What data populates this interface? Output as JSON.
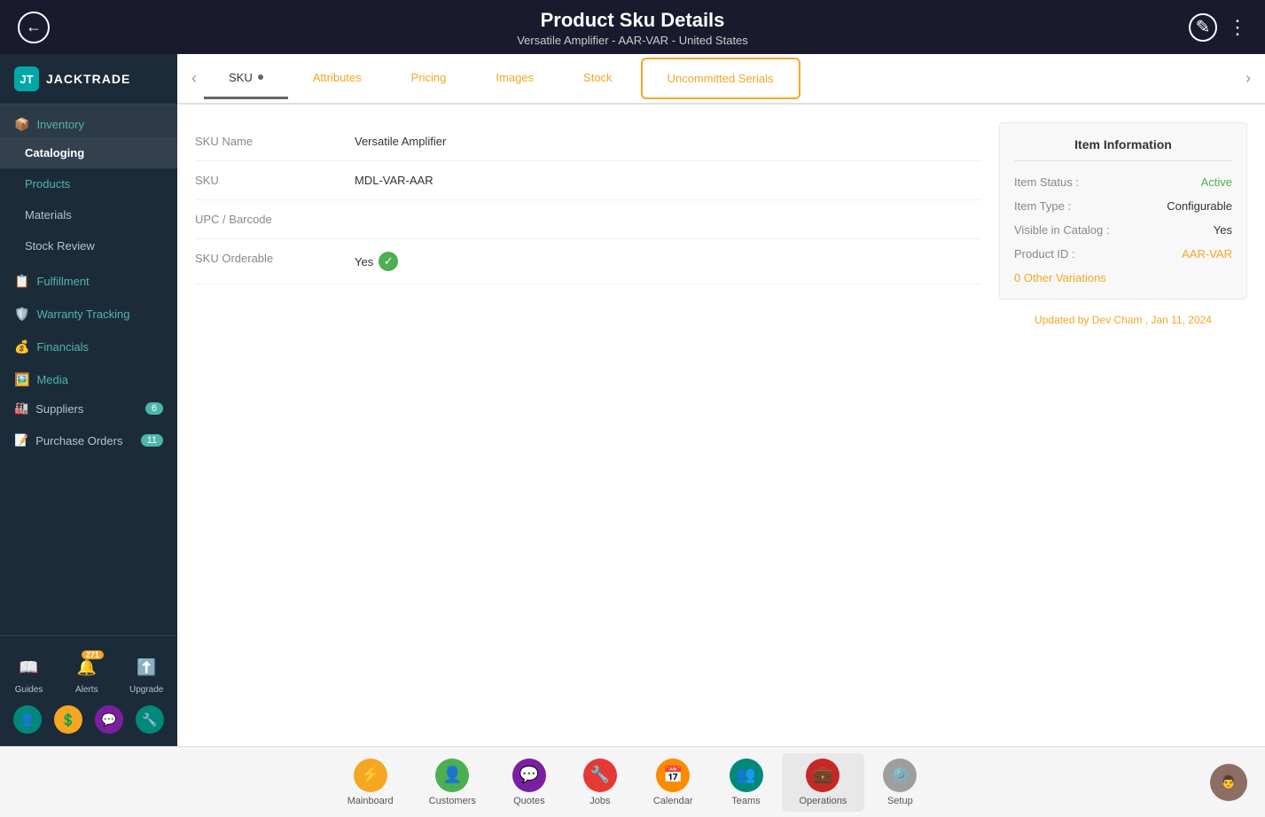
{
  "header": {
    "title": "Product Sku Details",
    "subtitle": "Versatile Amplifier - AAR-VAR - United States",
    "back_label": "←",
    "edit_icon": "✎",
    "more_icon": "⋮"
  },
  "sidebar": {
    "logo_text": "JACKTRADE",
    "sections": [
      {
        "name": "Inventory",
        "icon": "📦",
        "active": true,
        "sub_items": [
          {
            "label": "Cataloging",
            "active": true,
            "indent": true
          },
          {
            "label": "Products",
            "active_cyan": true,
            "indent": true
          },
          {
            "label": "Materials",
            "indent": true
          },
          {
            "label": "Stock Review",
            "indent": true
          }
        ]
      },
      {
        "name": "Fulfillment",
        "icon": "📋"
      },
      {
        "name": "Warranty Tracking",
        "icon": "🛡️"
      },
      {
        "name": "Financials",
        "icon": "💰"
      },
      {
        "name": "Media",
        "icon": "🖼️"
      },
      {
        "name": "Suppliers",
        "icon": "🏭",
        "badge": "6"
      },
      {
        "name": "Purchase Orders",
        "icon": "📝",
        "badge": "11"
      }
    ],
    "bottom": {
      "guides_label": "Guides",
      "alerts_label": "Alerts",
      "alerts_badge": "271",
      "upgrade_label": "Upgrade"
    }
  },
  "tabs": [
    {
      "label": "SKU",
      "active": true
    },
    {
      "label": "Attributes",
      "orange": true
    },
    {
      "label": "Pricing",
      "orange": true
    },
    {
      "label": "Images",
      "orange": true
    },
    {
      "label": "Stock",
      "orange": true
    },
    {
      "label": "Uncommitted Serials",
      "bordered": true
    }
  ],
  "fields": [
    {
      "label": "SKU Name",
      "value": "Versatile Amplifier",
      "type": "text"
    },
    {
      "label": "SKU",
      "value": "MDL-VAR-AAR",
      "type": "text"
    },
    {
      "label": "UPC / Barcode",
      "value": "",
      "type": "text"
    },
    {
      "label": "SKU Orderable",
      "value": "Yes",
      "type": "check"
    }
  ],
  "info_card": {
    "title": "Item Information",
    "rows": [
      {
        "label": "Item Status :",
        "value": "Active",
        "color": "green"
      },
      {
        "label": "Item Type :",
        "value": "Configurable",
        "color": "normal"
      },
      {
        "label": "Visible in Catalog :",
        "value": "Yes",
        "color": "normal"
      },
      {
        "label": "Product ID :",
        "value": "AAR-VAR",
        "color": "orange"
      }
    ],
    "link": "0 Other Variations",
    "updated_text": "Updated by",
    "updated_by": "Dev Cham",
    "updated_date": ", Jan 11, 2024"
  },
  "taskbar": {
    "items": [
      {
        "label": "Mainboard",
        "icon": "⚡",
        "color": "icon-yellow"
      },
      {
        "label": "Customers",
        "icon": "👤",
        "color": "icon-green"
      },
      {
        "label": "Quotes",
        "icon": "💬",
        "color": "icon-purple"
      },
      {
        "label": "Jobs",
        "icon": "🔧",
        "color": "icon-red"
      },
      {
        "label": "Calendar",
        "icon": "📅",
        "color": "icon-orange"
      },
      {
        "label": "Teams",
        "icon": "👥",
        "color": "icon-teal"
      },
      {
        "label": "Operations",
        "icon": "💼",
        "color": "icon-dark-red",
        "active": true
      },
      {
        "label": "Setup",
        "icon": "⚙️",
        "color": "icon-gray"
      }
    ]
  }
}
